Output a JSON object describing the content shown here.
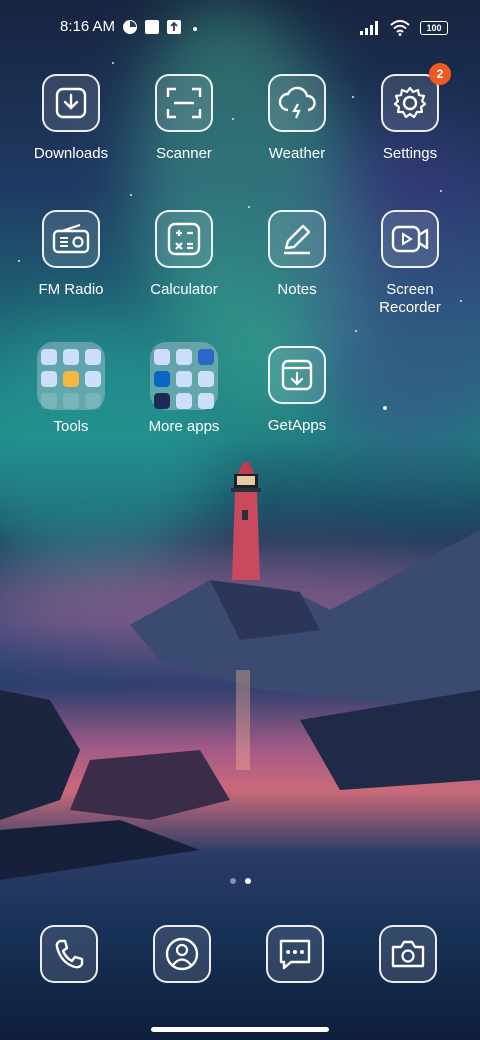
{
  "status": {
    "time": "8:16 AM",
    "battery": "100"
  },
  "apps": {
    "downloads": "Downloads",
    "scanner": "Scanner",
    "weather": "Weather",
    "settings": "Settings",
    "settings_badge": "2",
    "fm_radio": "FM Radio",
    "calculator": "Calculator",
    "notes": "Notes",
    "screen_recorder_line1": "Screen",
    "screen_recorder_line2": "Recorder",
    "tools": "Tools",
    "more_apps": "More apps",
    "getapps": "GetApps"
  },
  "dock": [
    "phone-icon",
    "contacts-icon",
    "messages-icon",
    "camera-icon"
  ],
  "page_indicator": {
    "count": 2,
    "active": 2
  },
  "accent_colors": {
    "badge": "#f05a22"
  }
}
